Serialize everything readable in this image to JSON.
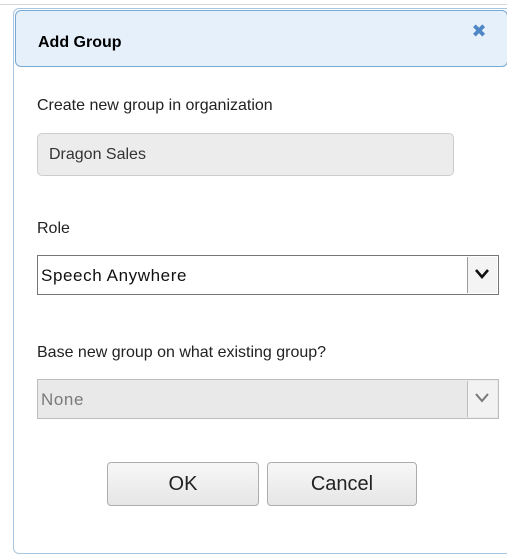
{
  "dialog": {
    "title": "Add Group",
    "close_icon": "close-icon",
    "close_glyph": "✖"
  },
  "organization": {
    "label": "Create new group in organization",
    "value": "Dragon Sales"
  },
  "role": {
    "label": "Role",
    "selected": "Speech Anywhere"
  },
  "base_group": {
    "label": "Base new group on what existing group?",
    "selected": "None",
    "disabled": true
  },
  "buttons": {
    "ok_label": "OK",
    "cancel_label": "Cancel"
  },
  "colors": {
    "titlebar_background": "#e6f0fa",
    "titlebar_border": "#79a8d3",
    "close_icon": "#4f86c6"
  }
}
